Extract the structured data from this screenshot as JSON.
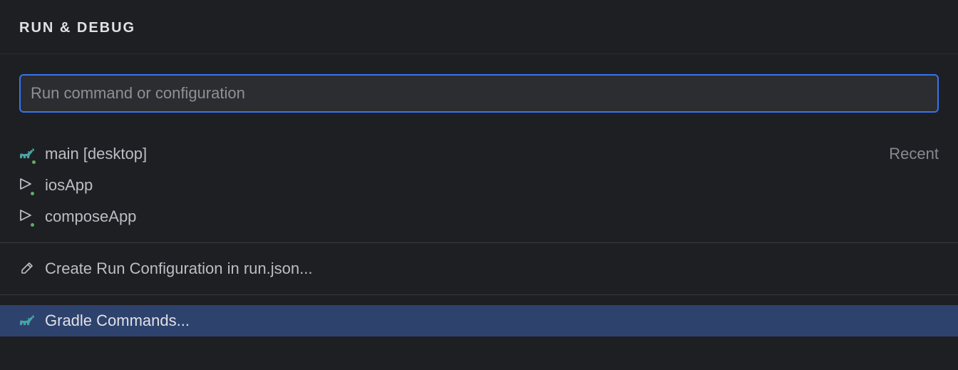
{
  "header": {
    "title": "RUN & DEBUG"
  },
  "search": {
    "placeholder": "Run command or configuration",
    "value": ""
  },
  "configs": [
    {
      "icon": "gradle",
      "label": "main [desktop]",
      "hint": "Recent"
    },
    {
      "icon": "run",
      "label": "iosApp",
      "hint": ""
    },
    {
      "icon": "run",
      "label": "composeApp",
      "hint": ""
    }
  ],
  "actions": {
    "create": {
      "label": "Create Run Configuration in run.json..."
    },
    "gradle": {
      "label": "Gradle Commands..."
    }
  }
}
